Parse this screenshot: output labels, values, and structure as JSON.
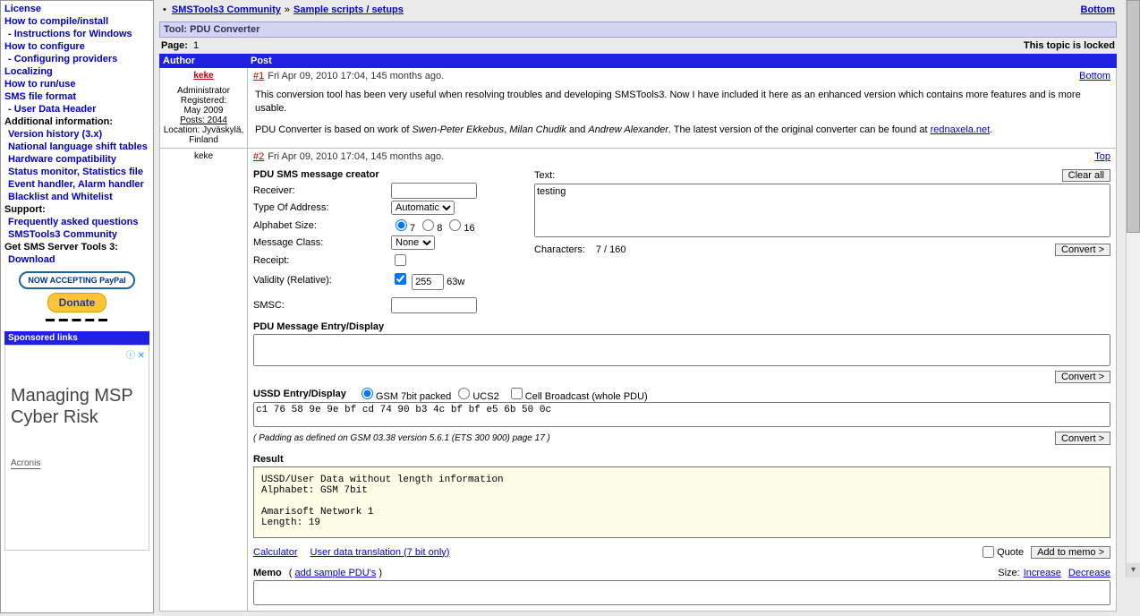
{
  "sidebar": {
    "nav": [
      "License",
      "How to compile/install",
      "- Instructions for Windows",
      "How to configure",
      "- Configuring providers",
      "Localizing",
      "How to run/use",
      "SMS file format",
      "- User Data Header"
    ],
    "section_additional": "Additional information:",
    "additional": [
      "Version history (3.x)",
      "National language shift tables",
      "Hardware compatibility",
      "Status monitor, Statistics file",
      "Event handler, Alarm handler",
      "Blacklist and Whitelist"
    ],
    "section_support": "Support:",
    "support": [
      "Frequently asked questions",
      "SMSTools3 Community"
    ],
    "get_line": "Get SMS Server Tools 3:",
    "download": "Download",
    "paypal_text": "NOW ACCEPTING PayPal",
    "donate": "Donate",
    "sponsored_head": "Sponsored links",
    "ad_close": "ⓘ ✕",
    "ad_text": "Managing\nMSP\nCyber Risk",
    "ad_brand": "Acronis"
  },
  "breadcrumb": {
    "a": "SMSTools3 Community",
    "sep": "»",
    "b": "Sample scripts / setups",
    "bottom": "Bottom"
  },
  "title": "Tool: PDU Converter",
  "pageline": {
    "page_label": "Page:",
    "page_num": "1",
    "locked": "This topic is locked"
  },
  "tablehead": {
    "author": "Author",
    "post": "Post"
  },
  "post1": {
    "author": "keke",
    "role": "Administrator",
    "regd_label": "Registered:",
    "regd": "May 2009",
    "posts_label": "Posts: 2044",
    "loc_label": "Location: Jyväskylä, Finland",
    "num": "#1",
    "date": "Fri Apr 09, 2010 17:04, 145 months ago.",
    "link": "Bottom",
    "line1": "This conversion tool has been very useful when resolving troubles and developing SMSTools3. Now I have included it here as an enhanced version which contains more features and is more usable.",
    "line2a": "PDU Converter is based on work of ",
    "auth1": "Swen-Peter Ekkebus",
    "sep1": ", ",
    "auth2": "Milan Chudik",
    "sep2": " and ",
    "auth3": "Andrew Alexander",
    "line2b": ". The latest version of the original converter can be found at ",
    "extlink": "rednaxela.net",
    "period": "."
  },
  "post2": {
    "author": "keke",
    "num": "#2",
    "date": "Fri Apr 09, 2010 17:04, 145 months ago.",
    "link": "Top"
  },
  "creator": {
    "title": "PDU SMS message creator",
    "receiver": "Receiver:",
    "receiver_val": "",
    "toa": "Type Of Address:",
    "toa_val": "Automatic",
    "alpha": "Alphabet Size:",
    "r7": "7",
    "r8": "8",
    "r16": "16",
    "mclass": "Message Class:",
    "mclass_val": "None",
    "receipt": "Receipt:",
    "validity": "Validity (Relative):",
    "validity_val": "255",
    "validity_suffix": "63w",
    "smsc": "SMSC:",
    "smsc_val": "",
    "text_label": "Text:",
    "text_val": "testing",
    "clear": "Clear all",
    "chars_label": "Characters:",
    "chars_val": "7 / 160",
    "convert": "Convert >"
  },
  "pdu": {
    "title": "PDU Message Entry/Display",
    "val": "",
    "convert": "Convert >"
  },
  "ussd": {
    "title": "USSD Entry/Display",
    "opt1": "GSM 7bit packed",
    "opt2": "UCS2",
    "opt3": "Cell Broadcast (whole PDU)",
    "val": "c1 76 58 9e 9e bf cd 74 90 b3 4c bf bf e5 6b 50 0c",
    "padding": "( Padding as defined on GSM 03.38 version 5.6.1 (ETS 300 900) page 17 )",
    "convert": "Convert >"
  },
  "result": {
    "title": "Result",
    "text": "USSD/User Data without length information\nAlphabet: GSM 7bit\n\nAmarisoft Network 1\nLength: 19"
  },
  "under": {
    "calc": "Calculator",
    "udt": "User data translation (7 bit only)",
    "quote": "Quote",
    "addmemo": "Add to memo >"
  },
  "memo": {
    "title": "Memo",
    "add": "add sample PDU's",
    "size_label": "Size:",
    "inc": "Increase",
    "dec": "Decrease",
    "val": ""
  }
}
